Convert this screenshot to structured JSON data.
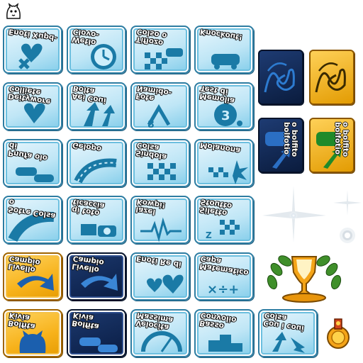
{
  "tiles": [
    {
      "id": "r1c1",
      "label": "Enoti Xupd-",
      "style": "blue",
      "icon": "heart-x-icon"
    },
    {
      "id": "r1c2",
      "label": "Wetlo Clovo-",
      "style": "blue",
      "icon": "clock-icon"
    },
    {
      "id": "r1c3",
      "label": "Tiflozo Colso o",
      "style": "blue",
      "icon": "checkered-flag-car-icon"
    },
    {
      "id": "r1c4",
      "label": "Knockout!",
      "style": "blue",
      "icon": "car-bump-icon"
    },
    {
      "id": "r2c1",
      "label": "Deitywore Colliete",
      "style": "blue",
      "icon": "heart-icon"
    },
    {
      "id": "r2c2",
      "label": "Aei Coui Bolta",
      "style": "blue",
      "icon": "arrows-up-icon"
    },
    {
      "id": "r2c3",
      "label": "Fote Namido-",
      "style": "blue",
      "icon": "split-path-icon"
    },
    {
      "id": "r2c4",
      "label": "Memolia Test di",
      "style": "blue",
      "icon": "number-bubble-icon"
    },
    {
      "id": "r3c1",
      "label": "Pnufa olo di",
      "style": "blue",
      "icon": "cars-icon"
    },
    {
      "id": "r3c2",
      "label": "Gelopo",
      "style": "blue",
      "icon": "curve-road-icon"
    },
    {
      "id": "r3c3",
      "label": "Sindola Colsa",
      "style": "blue",
      "icon": "checkered-flag-icon"
    },
    {
      "id": "r3c4",
      "label": "Molanona",
      "style": "blue",
      "icon": "starburst-flag-icon"
    },
    {
      "id": "r4c1",
      "label": "Sotre Colsa o",
      "style": "blue",
      "icon": "track-curve-icon"
    },
    {
      "id": "r4c2",
      "label": "qi toto ticaccia",
      "style": "blue",
      "icon": "camera-icon"
    },
    {
      "id": "r4c3",
      "label": "Iazel Kowpi!",
      "style": "blue",
      "icon": "heartbeat-icon"
    },
    {
      "id": "r4c4",
      "label": "Siletto Stoutto",
      "style": "blue",
      "icon": "flag-race-icon"
    },
    {
      "id": "r5c1",
      "label": "Livello Campio",
      "style": "yellow",
      "icon": "arrow-curve-icon"
    },
    {
      "id": "r5c2",
      "label": "Livello Campio",
      "style": "navy",
      "icon": "arrow-curve-icon"
    },
    {
      "id": "r5c3",
      "label": "Enoti Re di",
      "style": "blue",
      "icon": "hearts-icon"
    },
    {
      "id": "r5c4",
      "label": "Matematico Capa",
      "style": "blue",
      "icon": "math-symbols-icon"
    },
    {
      "id": "r6c1",
      "label": "Bolfita Kivia",
      "style": "yellow",
      "icon": "cat-icon"
    },
    {
      "id": "r6c2",
      "label": "Bolfita Kivia",
      "style": "navy",
      "icon": "cars-icon"
    },
    {
      "id": "r6c3",
      "label": "Velocita Massima",
      "style": "blue",
      "icon": "speedometer-icon"
    },
    {
      "id": "r6c4",
      "label": "Basso Convolio",
      "style": "blue",
      "icon": "podium-icon"
    },
    {
      "id": "r6c5",
      "label": "Cou i coui Colsa",
      "style": "blue",
      "icon": "arrows-split-icon"
    }
  ],
  "side_cards": [
    {
      "id": "s1",
      "label": "",
      "style": "navy",
      "icon": "signature-icon"
    },
    {
      "id": "s2",
      "label": "",
      "style": "yellow",
      "icon": "signature-icon"
    },
    {
      "id": "s3",
      "label": "o bolfito bolfotio",
      "style": "navy",
      "icon": "car-arrow-icon"
    },
    {
      "id": "s4",
      "label": "o bolfito bolfotio",
      "style": "yellow",
      "icon": "car-arrow-icon"
    }
  ],
  "misc": {
    "corner_icon": "cat-face-icon",
    "sparkle_icons": [
      "sparkle-large-icon",
      "sparkle-small-icon",
      "glow-dot-icon"
    ],
    "trophy_icon": "trophy-laurel-icon",
    "medal_icon": "medal-icon"
  },
  "colors": {
    "blue_tile": "#bfe6f6",
    "blue_art": "#1a7aa6",
    "yellow_tile": "#f7b21b",
    "navy_tile": "#0f2550"
  }
}
